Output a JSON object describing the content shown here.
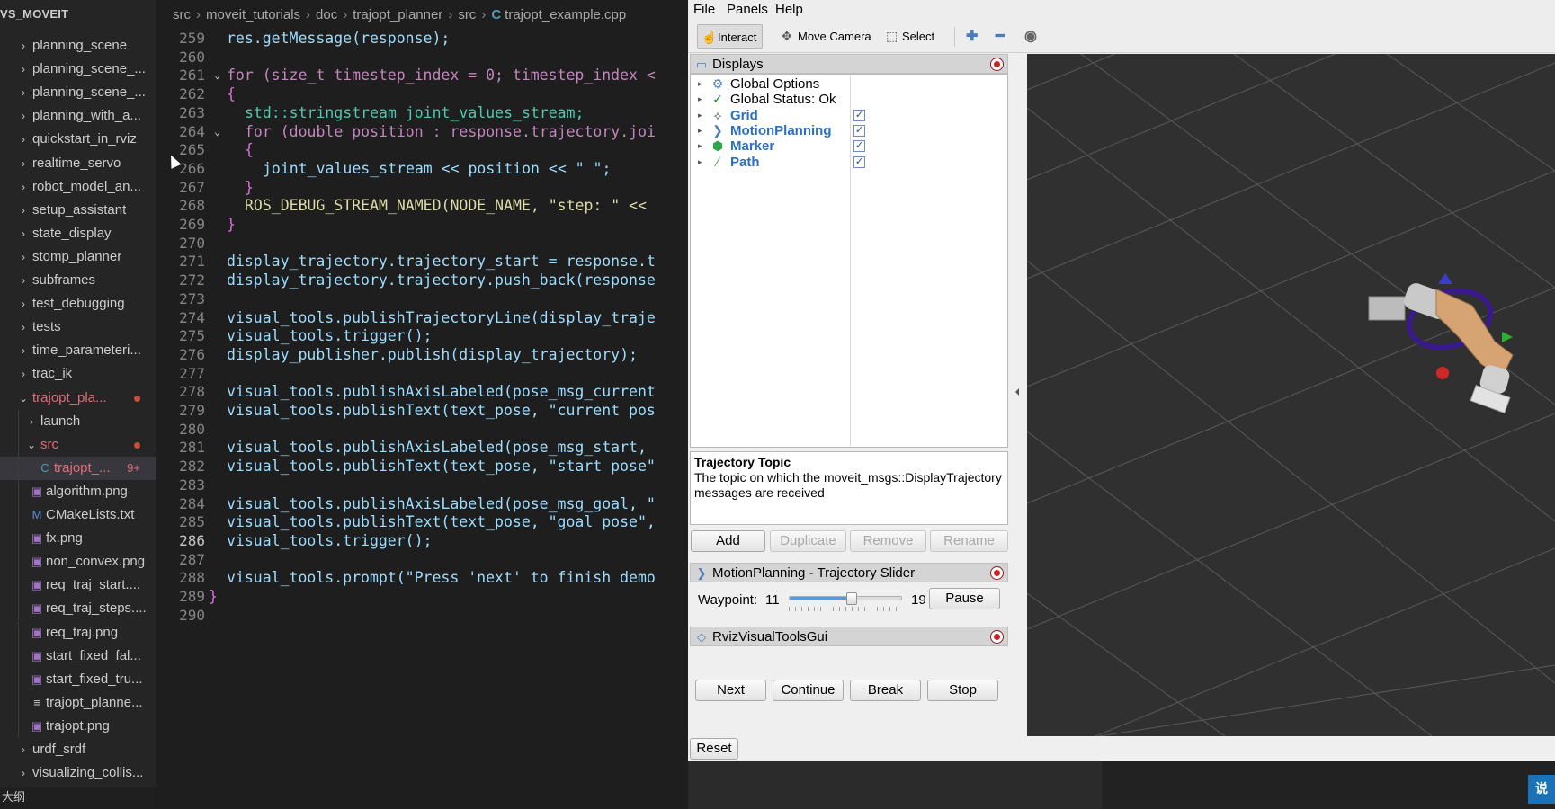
{
  "explorer": {
    "title": "VS_MOVEIT",
    "items": [
      {
        "label": "planning_scene",
        "type": "folder"
      },
      {
        "label": "planning_scene_...",
        "type": "folder"
      },
      {
        "label": "planning_scene_...",
        "type": "folder"
      },
      {
        "label": "planning_with_a...",
        "type": "folder"
      },
      {
        "label": "quickstart_in_rviz",
        "type": "folder"
      },
      {
        "label": "realtime_servo",
        "type": "folder"
      },
      {
        "label": "robot_model_an...",
        "type": "folder"
      },
      {
        "label": "setup_assistant",
        "type": "folder"
      },
      {
        "label": "state_display",
        "type": "folder"
      },
      {
        "label": "stomp_planner",
        "type": "folder"
      },
      {
        "label": "subframes",
        "type": "folder"
      },
      {
        "label": "test_debugging",
        "type": "folder"
      },
      {
        "label": "tests",
        "type": "folder"
      },
      {
        "label": "time_parameteri...",
        "type": "folder"
      },
      {
        "label": "trac_ik",
        "type": "folder"
      },
      {
        "label": "trajopt_pla...",
        "type": "folder-open"
      },
      {
        "label": "launch",
        "type": "folder"
      },
      {
        "label": "src",
        "type": "folder-open"
      },
      {
        "label": "trajopt_...",
        "type": "cpp",
        "badge": "9+"
      },
      {
        "label": "algorithm.png",
        "type": "image"
      },
      {
        "label": "CMakeLists.txt",
        "type": "cmake"
      },
      {
        "label": "fx.png",
        "type": "image"
      },
      {
        "label": "non_convex.png",
        "type": "image"
      },
      {
        "label": "req_traj_start....",
        "type": "image"
      },
      {
        "label": "req_traj_steps....",
        "type": "image"
      },
      {
        "label": "req_traj.png",
        "type": "image"
      },
      {
        "label": "start_fixed_fal...",
        "type": "image"
      },
      {
        "label": "start_fixed_tru...",
        "type": "image"
      },
      {
        "label": "trajopt_planne...",
        "type": "text"
      },
      {
        "label": "trajopt.png",
        "type": "image"
      },
      {
        "label": "urdf_srdf",
        "type": "folder"
      },
      {
        "label": "visualizing_collis...",
        "type": "folder"
      }
    ],
    "outline_label": "大纲"
  },
  "breadcrumb": {
    "parts": [
      "src",
      "moveit_tutorials",
      "doc",
      "trajopt_planner",
      "src"
    ],
    "file_icon": "C",
    "file": "trajopt_example.cpp"
  },
  "code": {
    "current_line": "286",
    "lines": [
      {
        "n": "259",
        "text": "res.getMessage(response);"
      },
      {
        "n": "260",
        "text": ""
      },
      {
        "n": "261",
        "text": "for (size_t timestep_index = 0; timestep_index <"
      },
      {
        "n": "262",
        "text": "{"
      },
      {
        "n": "263",
        "text": "std::stringstream joint_values_stream;"
      },
      {
        "n": "264",
        "text": "for (double position : response.trajectory.joi"
      },
      {
        "n": "265",
        "text": "{"
      },
      {
        "n": "266",
        "text": "joint_values_stream << position << \" \";"
      },
      {
        "n": "267",
        "text": "}"
      },
      {
        "n": "268",
        "text": "ROS_DEBUG_STREAM_NAMED(NODE_NAME, \"step: \" <<"
      },
      {
        "n": "269",
        "text": "}"
      },
      {
        "n": "270",
        "text": ""
      },
      {
        "n": "271",
        "text": "display_trajectory.trajectory_start = response.t"
      },
      {
        "n": "272",
        "text": "display_trajectory.trajectory.push_back(response"
      },
      {
        "n": "273",
        "text": ""
      },
      {
        "n": "274",
        "text": "visual_tools.publishTrajectoryLine(display_traje"
      },
      {
        "n": "275",
        "text": "visual_tools.trigger();"
      },
      {
        "n": "276",
        "text": "display_publisher.publish(display_trajectory);"
      },
      {
        "n": "277",
        "text": ""
      },
      {
        "n": "278",
        "text": "visual_tools.publishAxisLabeled(pose_msg_current"
      },
      {
        "n": "279",
        "text": "visual_tools.publishText(text_pose, \"current pos"
      },
      {
        "n": "280",
        "text": ""
      },
      {
        "n": "281",
        "text": "visual_tools.publishAxisLabeled(pose_msg_start, "
      },
      {
        "n": "282",
        "text": "visual_tools.publishText(text_pose, \"start pose\""
      },
      {
        "n": "283",
        "text": ""
      },
      {
        "n": "284",
        "text": "visual_tools.publishAxisLabeled(pose_msg_goal, \""
      },
      {
        "n": "285",
        "text": "visual_tools.publishText(text_pose, \"goal pose\","
      },
      {
        "n": "286",
        "text": "visual_tools.trigger();"
      },
      {
        "n": "287",
        "text": ""
      },
      {
        "n": "288",
        "text": "visual_tools.prompt(\"Press 'next' to finish demo"
      },
      {
        "n": "289",
        "text": "}"
      },
      {
        "n": "290",
        "text": ""
      }
    ]
  },
  "rviz": {
    "menu": [
      "File",
      "Panels",
      "Help"
    ],
    "toolbar": {
      "interact": "Interact",
      "move_camera": "Move Camera",
      "select": "Select"
    },
    "displays_panel": {
      "title": "Displays",
      "items": [
        {
          "label": "Global Options",
          "icon": "gear-icon",
          "checked": null,
          "highlight": false
        },
        {
          "label": "Global Status: Ok",
          "icon": "checkmark-icon",
          "checked": null,
          "highlight": false
        },
        {
          "label": "Grid",
          "icon": "grid-icon",
          "checked": true,
          "highlight": true
        },
        {
          "label": "MotionPlanning",
          "icon": "motion-planning-icon",
          "checked": true,
          "highlight": true
        },
        {
          "label": "Marker",
          "icon": "marker-cube-icon",
          "checked": true,
          "highlight": true
        },
        {
          "label": "Path",
          "icon": "path-icon",
          "checked": true,
          "highlight": true
        }
      ]
    },
    "description": {
      "title": "Trajectory Topic",
      "text": "The topic on which the moveit_msgs::DisplayTrajectory messages are received"
    },
    "display_buttons": {
      "add": "Add",
      "duplicate": "Duplicate",
      "remove": "Remove",
      "rename": "Rename"
    },
    "trajectory_slider": {
      "title": "MotionPlanning - Trajectory Slider",
      "waypoint_label": "Waypoint:",
      "current": "11",
      "max": "19",
      "position_fraction": 0.55,
      "pause": "Pause"
    },
    "visual_tools": {
      "title": "RvizVisualToolsGui",
      "next": "Next",
      "continue": "Continue",
      "break": "Break",
      "stop": "Stop"
    },
    "reset": "Reset"
  },
  "colors": {
    "editor_bg": "#1e1e1e",
    "sidebar_bg": "#252526",
    "rviz_bg": "#efefef",
    "viewport_bg": "#303030",
    "accent_blue": "#2a6fc0"
  },
  "overlay_button": "说"
}
